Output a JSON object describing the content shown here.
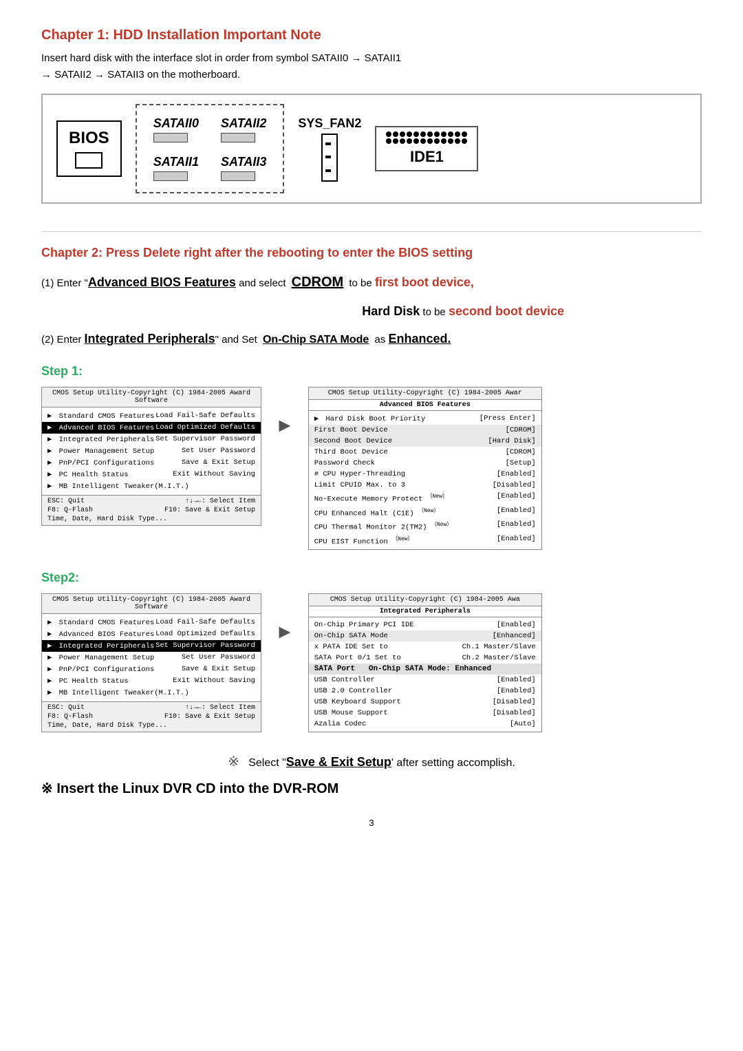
{
  "page": {
    "chapter1": {
      "title": "Chapter 1: HDD Installation Important Note",
      "intro": "Insert hard disk with the interface slot in order from symbol SATAII0  →   SATAII1  →  SATAII2  →  SATAII3 on the motherboard.",
      "intro_parts": {
        "line1": "Insert hard disk with the interface slot in order from symbol SATAII0  →   SATAII1",
        "line2": "→  SATAII2  →  SATAII3 on the motherboard."
      },
      "diagram": {
        "bios_label": "BIOS",
        "slots": [
          "SATAII0",
          "SATAII2",
          "SATAII1",
          "SATAII3"
        ],
        "sysfan": "SYS_FAN2",
        "ide": "IDE1"
      }
    },
    "chapter2": {
      "title": "Chapter 2: Press  Delete  right after the rebooting to enter the BIOS setting",
      "step1_instruction1_prefix": "(1) Enter \"",
      "step1_instruction1_bold": "Advanced BIOS Features",
      "step1_instruction1_suffix": " and select  ",
      "step1_cdrom": "CDROM",
      "step1_cdrom_suffix": "  to be ",
      "step1_first": "first boot device,",
      "step1_hdd_prefix": "Hard Disk",
      "step1_hdd_suffix": "  to be ",
      "step1_second": "second boot device",
      "step2_prefix": "(2) Enter  ",
      "step2_bold": "Integrated Peripherals",
      "step2_middle": "\" and Set  ",
      "step2_sata": "On-Chip SATA Mode",
      "step2_suffix": "  as  ",
      "step2_enhanced": "Enhanced."
    },
    "step1": {
      "title": "Step 1:",
      "left_screen": {
        "title": "CMOS Setup Utility-Copyright (C) 1984-2005 Award Software",
        "items": [
          {
            "label": "Standard CMOS Features",
            "value": "Load Fail-Safe Defaults",
            "selected": false,
            "has_arrow": true
          },
          {
            "label": "Advanced BIOS Features",
            "value": "Load Optimized Defaults",
            "selected": true,
            "has_arrow": true
          },
          {
            "label": "Integrated Peripherals",
            "value": "Set Supervisor Password",
            "selected": false,
            "has_arrow": true
          },
          {
            "label": "Power Management Setup",
            "value": "Set User Password",
            "selected": false,
            "has_arrow": true
          },
          {
            "label": "PnP/PCI Configurations",
            "value": "Save & Exit Setup",
            "selected": false,
            "has_arrow": true
          },
          {
            "label": "PC Health Status",
            "value": "Exit Without Saving",
            "selected": false,
            "has_arrow": true
          },
          {
            "label": "MB Intelligent Tweaker(M.I.T.)",
            "value": "",
            "selected": false,
            "has_arrow": true
          }
        ],
        "footer": [
          {
            "left": "ESC: Quit",
            "right": "↑↓→←: Select Item"
          },
          {
            "left": "F8: Q-Flash",
            "right": "F10: Save & Exit Setup"
          },
          {
            "left": "Time, Date, Hard Disk Type...",
            "right": ""
          }
        ]
      },
      "right_screen": {
        "title": "CMOS Setup Utility-Copyright (C) 1984-2005 Awar",
        "subtitle": "Advanced BIOS Features",
        "items": [
          {
            "label": "Hard Disk Boot Priority",
            "value": "[Press Enter]",
            "has_arrow": true,
            "selected": false
          },
          {
            "label": "First Boot Device",
            "value": "[CDROM]",
            "selected": false,
            "highlight": true
          },
          {
            "label": "Second Boot Device",
            "value": "[Hard Disk]",
            "selected": false,
            "highlight": true
          },
          {
            "label": "Third Boot Device",
            "value": "[CDROM]",
            "selected": false
          },
          {
            "label": "Password Check",
            "value": "[Setup]",
            "selected": false
          },
          {
            "label": "# CPU Hyper-Threading",
            "value": "[Enabled]",
            "selected": false
          },
          {
            "label": "Limit CPUID Max. to 3",
            "value": "[Disabled]",
            "selected": false
          },
          {
            "label": "No-Execute Memory Protect (New)",
            "value": "[Enabled]",
            "selected": false
          },
          {
            "label": "CPU Enhanced Halt (C1E) (New)",
            "value": "[Enabled]",
            "selected": false
          },
          {
            "label": "CPU Thermal Monitor 2(TM2) (New)",
            "value": "[Enabled]",
            "selected": false
          },
          {
            "label": "CPU EIST Function (New)",
            "value": "[Enabled]",
            "selected": false
          }
        ]
      }
    },
    "step2": {
      "title": "Step2:",
      "left_screen": {
        "title": "CMOS Setup Utility-Copyright (C) 1984-2005 Award Software",
        "items": [
          {
            "label": "Standard CMOS Features",
            "value": "Load Fail-Safe Defaults",
            "selected": false,
            "has_arrow": true
          },
          {
            "label": "Advanced BIOS Features",
            "value": "Load Optimized Defaults",
            "selected": false,
            "has_arrow": true
          },
          {
            "label": "Integrated Peripherals",
            "value": "Set Supervisor Password",
            "selected": true,
            "has_arrow": true
          },
          {
            "label": "Power Management Setup",
            "value": "Set User Password",
            "selected": false,
            "has_arrow": true
          },
          {
            "label": "PnP/PCI Configurations",
            "value": "Save & Exit Setup",
            "selected": false,
            "has_arrow": true
          },
          {
            "label": "PC Health Status",
            "value": "Exit Without Saving",
            "selected": false,
            "has_arrow": true
          },
          {
            "label": "MB Intelligent Tweaker(M.I.T.)",
            "value": "",
            "selected": false,
            "has_arrow": true
          }
        ],
        "footer": [
          {
            "left": "ESC: Quit",
            "right": "↑↓→←: Select Item"
          },
          {
            "left": "F8: Q-Flash",
            "right": "F10: Save & Exit Setup"
          },
          {
            "left": "Time, Date, Hard Disk Type...",
            "right": ""
          }
        ]
      },
      "right_screen": {
        "title": "CMOS Setup Utility-Copyright (C) 1984-2005 Awa",
        "subtitle": "Integrated Peripherals",
        "items": [
          {
            "label": "On-Chip Primary PCI IDE",
            "value": "[Enabled]"
          },
          {
            "label": "On-Chip SATA Mode",
            "value": "[Enhanced]",
            "highlight": true
          },
          {
            "label": "x  PATA IDE Set to",
            "value": "Ch.1 Master/Slave"
          },
          {
            "label": "SATA Port",
            "value": "Ch.2 Master/Slave",
            "partial": "0/1 Set to"
          },
          {
            "label": "SATA Port",
            "value": "",
            "overlay": "On-Chip SATA Mode: Enhanced"
          },
          {
            "label": "USB Controller",
            "value": "[Enabled]"
          },
          {
            "label": "USB 2.0 Controller",
            "value": "[Enabled]"
          },
          {
            "label": "USB Keyboard Support",
            "value": "[Disabled]"
          },
          {
            "label": "USB Mouse Support",
            "value": "[Disabled]"
          },
          {
            "label": "Azalia Codec",
            "value": "[Auto]"
          }
        ]
      }
    },
    "note": {
      "symbol": "※",
      "text": "Select \"Save & Exit Setup\" after setting accomplish.",
      "text_parts": {
        "prefix": "Select \"",
        "bold": "Save & Exit Setup",
        "suffix": "' after setting accomplish."
      }
    },
    "final_note": {
      "symbol": "※",
      "text": " Insert the Linux DVR  CD into the DVR-ROM"
    },
    "page_number": "3"
  }
}
